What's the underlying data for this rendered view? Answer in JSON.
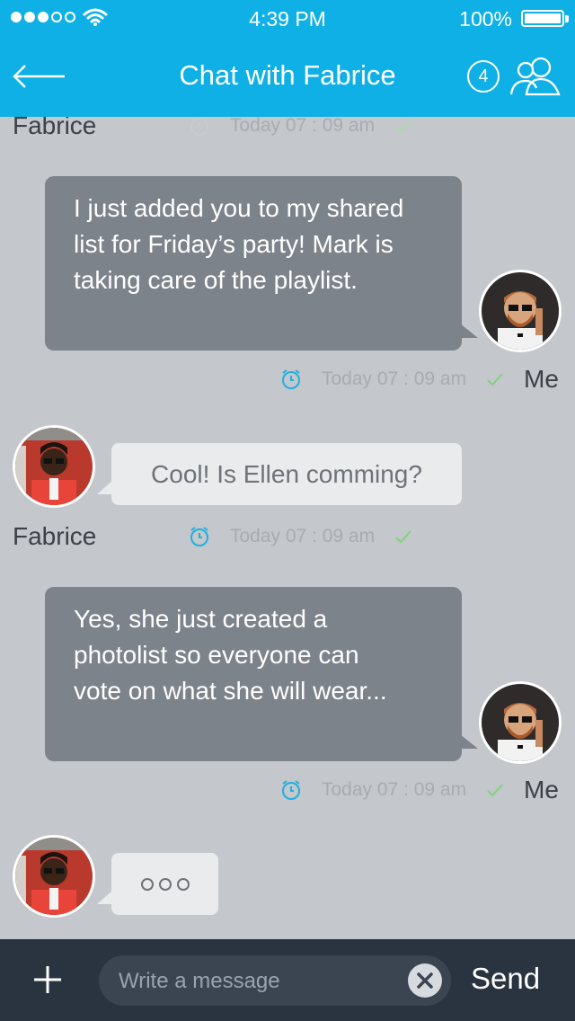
{
  "status_bar": {
    "time": "4:39 PM",
    "battery_percent": "100%",
    "signal_filled": 3,
    "signal_total": 5
  },
  "header": {
    "title": "Chat with Fabrice",
    "participant_count": "4",
    "back_icon": "back-arrow-icon",
    "group_icon": "group-icon"
  },
  "messages": [
    {
      "sender": "Fabrice",
      "time": "Today 07 : 09 am",
      "direction": "incoming",
      "partial": true
    },
    {
      "sender": "Me",
      "text_lines": [
        "I just added you to my shared",
        "list for Friday’s party! Mark is",
        "taking care of the playlist."
      ],
      "time": "Today 07 : 09 am",
      "direction": "outgoing"
    },
    {
      "sender": "Fabrice",
      "text": "Cool! Is Ellen comming?",
      "time": "Today 07 : 09 am",
      "direction": "incoming"
    },
    {
      "sender": "Me",
      "text_lines": [
        "Yes, she just created a",
        "photolist so everyone can",
        "vote on what she will wear..."
      ],
      "time": "Today 07 : 09 am",
      "direction": "outgoing"
    },
    {
      "sender": "Fabrice",
      "typing": true,
      "direction": "incoming"
    }
  ],
  "composer": {
    "placeholder": "Write a message",
    "send_label": "Send"
  },
  "colors": {
    "accent": "#0fb0e6",
    "background": "#c4c7cc",
    "outgoing_bubble": "#7d838b",
    "incoming_bubble": "#eaebed",
    "composer_bg": "#2a3440",
    "check": "#7fd47a",
    "clock": "#1fb0e0"
  }
}
